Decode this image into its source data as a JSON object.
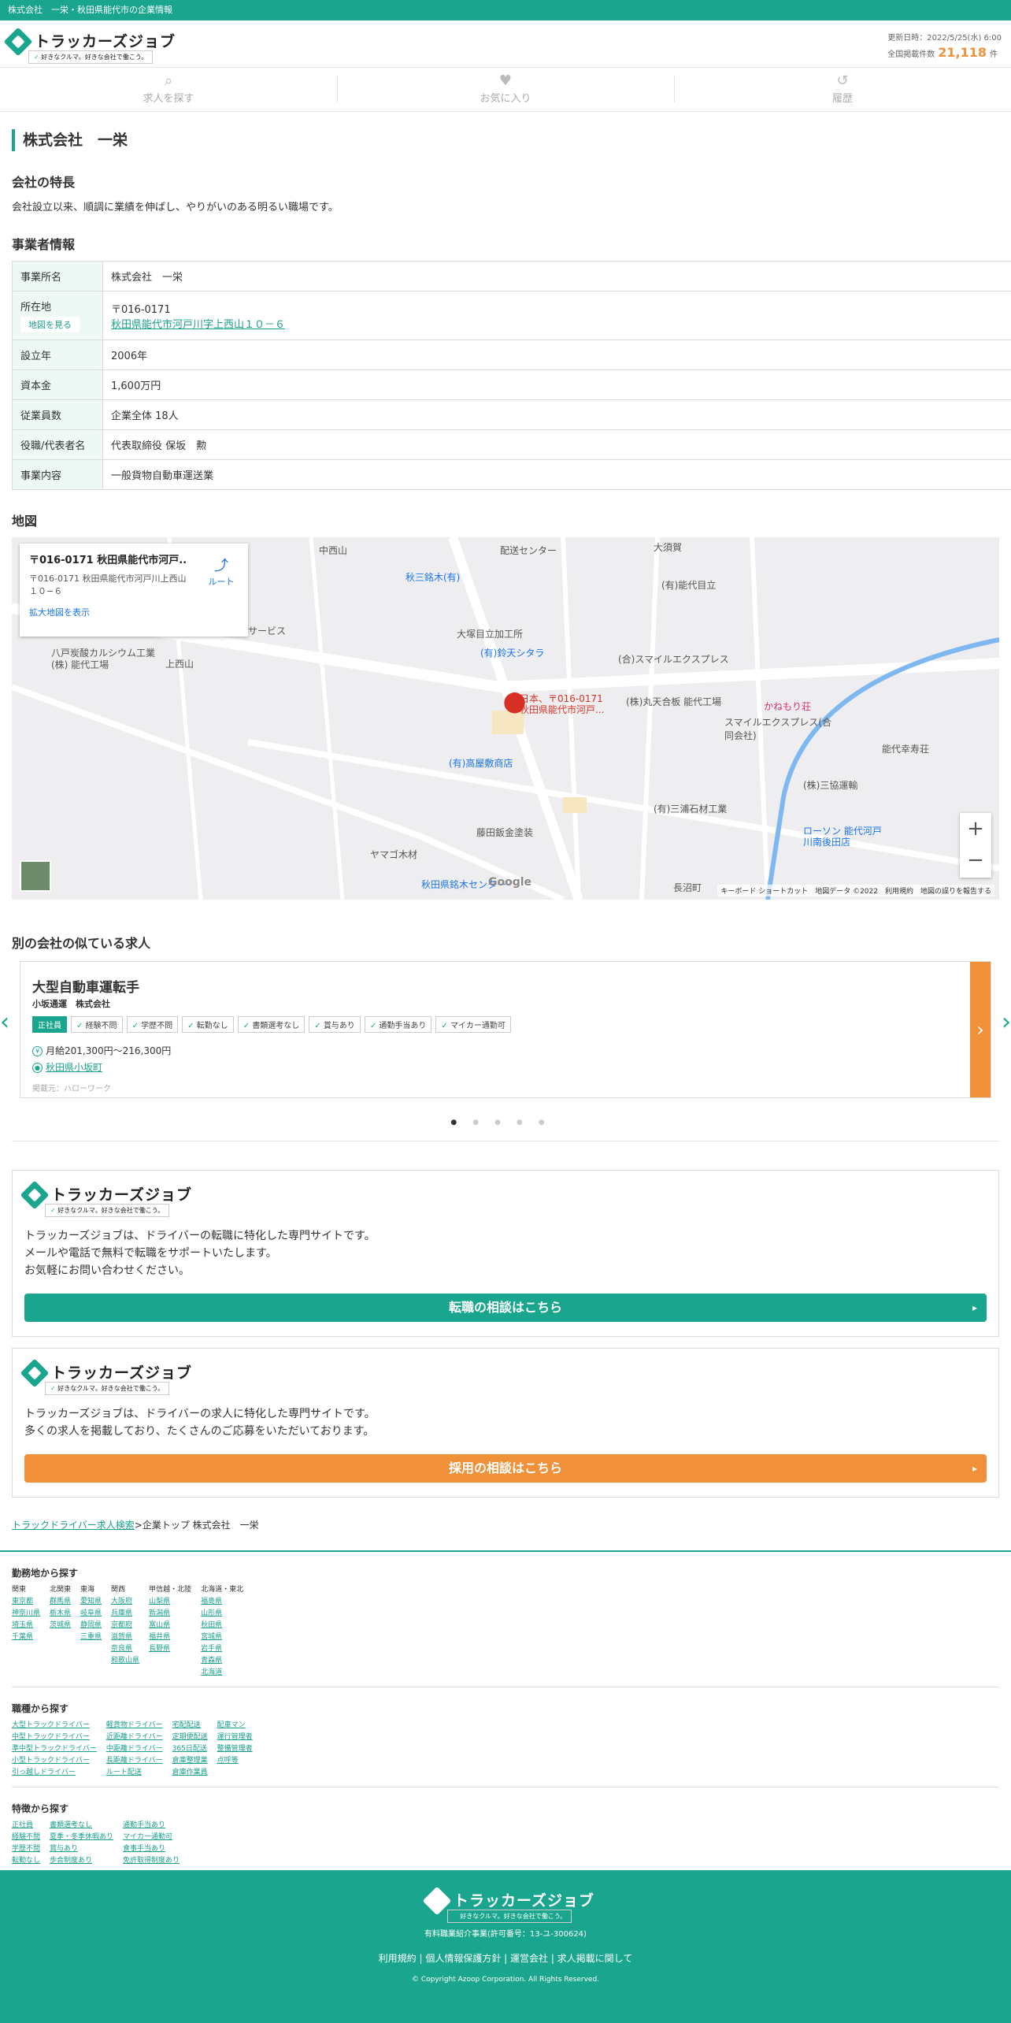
{
  "topbar": {
    "text": "株式会社　一栄・秋田県能代市の企業情報"
  },
  "header": {
    "logo_name": "トラッカーズジョブ",
    "logo_tagline": "好きなクルマ。好きな会社で働こう。",
    "updated": "更新日時：2022/5/25(水) 6:00",
    "total_label": "全国掲載件数",
    "total_count": "21,118",
    "total_unit": "件"
  },
  "nav": [
    {
      "label": "求人を探す",
      "icon": "search-icon"
    },
    {
      "label": "お気に入り",
      "icon": "heart-icon"
    },
    {
      "label": "履歴",
      "icon": "history-icon"
    }
  ],
  "page_title": "株式会社　一栄",
  "features": {
    "heading": "会社の特長",
    "text": "会社設立以来、順調に業績を伸ばし、やりがいのある明るい職場です。"
  },
  "company": {
    "heading": "事業者情報",
    "rows": [
      {
        "label": "事業所名",
        "value": "株式会社　一栄"
      },
      {
        "label": "所在地",
        "value": "〒016-0171",
        "link": "秋田県能代市河戸川字上西山１０－６",
        "button": "地図を見る"
      },
      {
        "label": "設立年",
        "value": "2006年"
      },
      {
        "label": "資本金",
        "value": "1,600万円"
      },
      {
        "label": "従業員数",
        "value": "企業全体 18人"
      },
      {
        "label": "役職/代表者名",
        "value": "代表取締役 保坂　勲"
      },
      {
        "label": "事業内容",
        "value": "一般貨物自動車運送業"
      }
    ]
  },
  "map": {
    "heading": "地図",
    "card_title": "〒016-0171 秋田県能代市河戸...",
    "card_address": "〒016-0171 秋田県能代市河戸川上西山１０−６",
    "card_link": "拡大地図を表示",
    "route_label": "ルート",
    "pin_label_1": "日本、〒016-0171",
    "pin_label_2": "秋田県能代市河戸...",
    "attribution": "キーボード ショートカット　地図データ ©2022　利用規約　地図の誤りを報告する",
    "google": "Google",
    "places": [
      "秋三銘木(有)",
      "(有)能代目立",
      "大塚目立加工所",
      "(有)鈴天シタラ",
      "(合)スマイルエクスプレス",
      "(株)丸天合板 能代工場",
      "スマイルエクスプレス(合同会社)",
      "かねもり荘",
      "能代幸寿荘",
      "(有)高屋敷商店",
      "(株)三協運輸",
      "(有)三浦石材工業",
      "藤田鈑金塗装",
      "ヤマゴ木材",
      "秋田県銘木センター",
      "ローソン 能代河戸川南後田店",
      "八戸炭酸カルシウム工業(株) 能代工場",
      "上西山",
      "中西山",
      "大須賀",
      "長沼町",
      "配送センター",
      "サービス"
    ]
  },
  "similar": {
    "heading": "別の会社の似ている求人",
    "job_title": "大型自動車運転手",
    "company": "小坂通運　株式会社",
    "tags": [
      "正社員",
      "経験不問",
      "学歴不問",
      "転勤なし",
      "書類選考なし",
      "賞与あり",
      "通勤手当あり",
      "マイカー通勤可"
    ],
    "salary": "月給201,300円〜216,300円",
    "location": "秋田県小坂町",
    "source": "掲載元：ハローワーク"
  },
  "promo1": {
    "text1": "トラッカーズジョブは、ドライバーの転職に特化した専門サイトです。",
    "text2": "メールや電話で無料で転職をサポートいたします。",
    "text3": "お気軽にお問い合わせください。",
    "button": "転職の相談はこちら",
    "color": "#1aa68e"
  },
  "promo2": {
    "text1": "トラッカーズジョブは、ドライバーの求人に特化した専門サイトです。",
    "text2": "多くの求人を掲載しており、たくさんのご応募をいただいております。",
    "button": "採用の相談はこちら",
    "color": "#f0913a"
  },
  "breadcrumb": {
    "link": "トラックドライバー求人検索",
    "sep": ">",
    "current": "企業トップ 株式会社　一栄"
  },
  "footnav": {
    "area_heading": "勤務地から探す",
    "areas": [
      {
        "h": "関東",
        "items": [
          "東京都",
          "神奈川県",
          "埼玉県",
          "千葉県"
        ]
      },
      {
        "h": "北関東",
        "items": [
          "群馬県",
          "栃木県",
          "茨城県"
        ]
      },
      {
        "h": "東海",
        "items": [
          "愛知県",
          "岐阜県",
          "静岡県",
          "三重県"
        ]
      },
      {
        "h": "関西",
        "items": [
          "大阪府",
          "兵庫県",
          "京都府",
          "滋賀県",
          "奈良県",
          "和歌山県"
        ]
      },
      {
        "h": "甲信越・北陸",
        "items": [
          "山梨県",
          "新潟県",
          "富山県",
          "福井県",
          "長野県"
        ]
      },
      {
        "h": "北海道・東北",
        "items": [
          "福島県",
          "山形県",
          "秋田県",
          "宮城県",
          "岩手県",
          "青森県",
          "北海道"
        ]
      }
    ],
    "job_heading": "職種から探す",
    "jobs": [
      [
        "大型トラックドライバー",
        "中型トラックドライバー",
        "準中型トラックドライバー",
        "小型トラックドライバー",
        "引っ越しドライバー"
      ],
      [
        "軽貨物ドライバー",
        "近距離ドライバー",
        "中距離ドライバー",
        "長距離ドライバー",
        "ルート配送"
      ],
      [
        "宅配配送",
        "定期便配送",
        "365日配送",
        "倉庫整理業",
        "倉庫作業員"
      ],
      [
        "配車マン",
        "運行管理者",
        "整備管理者",
        "点呼等"
      ]
    ],
    "feature_heading": "特徴から探す",
    "features": [
      [
        "正社員",
        "経験不問",
        "学歴不問",
        "転勤なし"
      ],
      [
        "書類選考なし",
        "夏季・冬季休暇あり",
        "賞与あり",
        "歩合制度あり"
      ],
      [
        "通勤手当あり",
        "マイカー通勤可",
        "食事手当あり",
        "免許取得制度あり"
      ]
    ]
  },
  "footer": {
    "license": "有料職業紹介事業(許可番号：13-ユ-300624)",
    "links": "利用規約 | 個人情報保護方針 | 運営会社 | 求人掲載に関して",
    "copyright": "© Copyright Azoop Corporation. All Rights Reserved."
  }
}
